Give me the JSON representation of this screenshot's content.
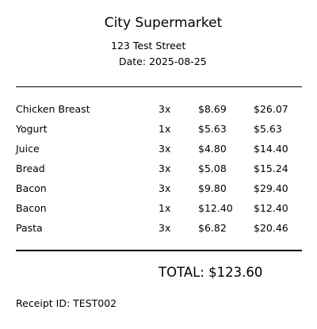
{
  "store": {
    "name": "City Supermarket",
    "address": "123 Test Street",
    "date_label": "Date:",
    "date": "2025-08-25"
  },
  "items": [
    {
      "name": "Chicken Breast",
      "qty": "3x",
      "price": "$8.69",
      "total": "$26.07"
    },
    {
      "name": "Yogurt",
      "qty": "1x",
      "price": "$5.63",
      "total": "$5.63"
    },
    {
      "name": "Juice",
      "qty": "3x",
      "price": "$4.80",
      "total": "$14.40"
    },
    {
      "name": "Bread",
      "qty": "3x",
      "price": "$5.08",
      "total": "$15.24"
    },
    {
      "name": "Bacon",
      "qty": "3x",
      "price": "$9.80",
      "total": "$29.40"
    },
    {
      "name": "Bacon",
      "qty": "1x",
      "price": "$12.40",
      "total": "$12.40"
    },
    {
      "name": "Pasta",
      "qty": "3x",
      "price": "$6.82",
      "total": "$20.46"
    }
  ],
  "summary": {
    "total_label": "TOTAL:",
    "total_value": "$123.60",
    "receipt_id_label": "Receipt ID:",
    "receipt_id": "TEST002"
  }
}
